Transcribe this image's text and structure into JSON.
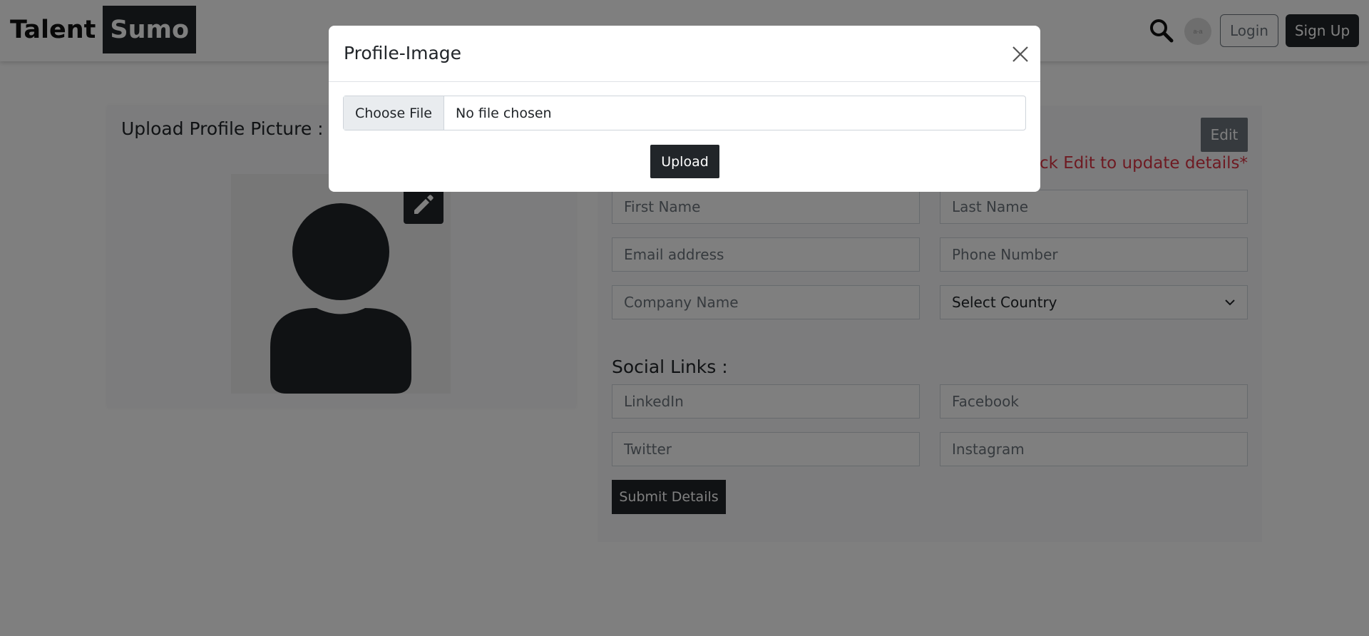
{
  "header": {
    "brand_part1": "Talent",
    "brand_part2": "Sumo",
    "avatar_text": "a-a",
    "login_label": "Login",
    "signup_label": "Sign Up"
  },
  "profile_picture": {
    "title": "Upload Profile Picture :"
  },
  "details": {
    "edit_label": "Edit",
    "edit_hint": "Click Edit to update details*",
    "first_name_placeholder": "First Name",
    "last_name_placeholder": "Last Name",
    "email_placeholder": "Email address",
    "phone_placeholder": "Phone Number",
    "company_placeholder": "Company Name",
    "country_select": "Select Country"
  },
  "social": {
    "title": "Social Links :",
    "linkedin_placeholder": "LinkedIn",
    "facebook_placeholder": "Facebook",
    "twitter_placeholder": "Twitter",
    "instagram_placeholder": "Instagram",
    "submit_label": "Submit Details"
  },
  "modal": {
    "title": "Profile-Image",
    "choose_file_label": "Choose File",
    "file_status": "No file chosen",
    "upload_label": "Upload"
  },
  "colors": {
    "primary_dark": "#212529",
    "secondary": "#6c757d",
    "danger": "#dc3545"
  },
  "icons": [
    "search-icon",
    "user-silhouette-icon",
    "pencil-icon",
    "close-icon",
    "chevron-down-icon"
  ]
}
